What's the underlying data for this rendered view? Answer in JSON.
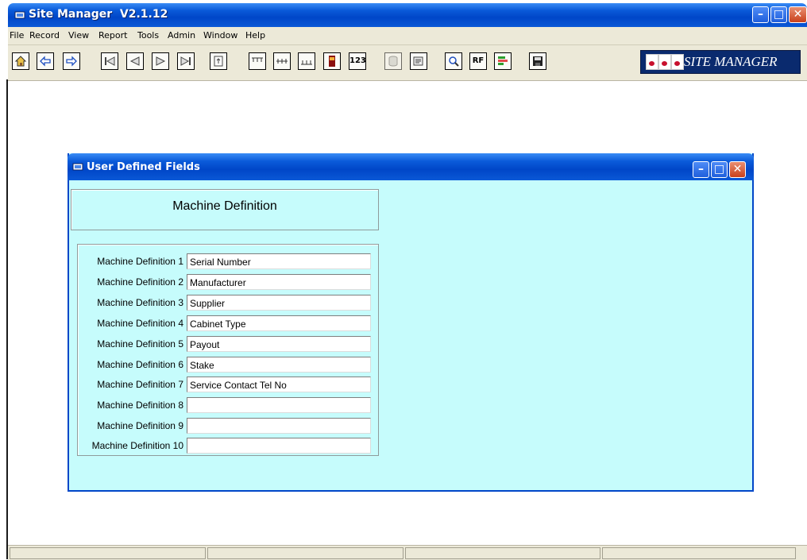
{
  "window": {
    "title": "Site Manager  V2.1.12",
    "controls": {
      "minimize": "–",
      "maximize": "□",
      "close": "✕"
    }
  },
  "menu": [
    "File",
    "Record",
    "View",
    "Report",
    "Tools",
    "Admin",
    "Window",
    "Help"
  ],
  "toolbar": {
    "buttons": [
      {
        "name": "home-icon"
      },
      {
        "name": "back-arrow-icon"
      },
      {
        "name": "forward-arrow-icon"
      },
      {
        "name": "first-record-icon"
      },
      {
        "name": "previous-record-icon"
      },
      {
        "name": "next-record-icon"
      },
      {
        "name": "last-record-icon"
      },
      {
        "name": "document-icon"
      },
      {
        "name": "layout-top-icon"
      },
      {
        "name": "layout-middle-icon"
      },
      {
        "name": "layout-bottom-icon"
      },
      {
        "name": "cabinet-icon"
      },
      {
        "name": "numbers-icon",
        "text": "123"
      },
      {
        "name": "database-icon"
      },
      {
        "name": "notes-icon"
      },
      {
        "name": "search-icon"
      },
      {
        "name": "rf-icon",
        "text": "RF"
      },
      {
        "name": "chart-icon"
      },
      {
        "name": "save-icon"
      }
    ],
    "logo_text": "SITE MANAGER"
  },
  "child_window": {
    "title": "User Defined Fields",
    "heading": "Machine Definition",
    "fields": [
      {
        "label": "Machine Definition 1",
        "value": "Serial Number"
      },
      {
        "label": "Machine Definition 2",
        "value": "Manufacturer"
      },
      {
        "label": "Machine Definition 3",
        "value": "Supplier"
      },
      {
        "label": "Machine Definition 4",
        "value": "Cabinet Type"
      },
      {
        "label": "Machine Definition 5",
        "value": "Payout"
      },
      {
        "label": "Machine Definition 6",
        "value": "Stake"
      },
      {
        "label": "Machine Definition 7",
        "value": "Service Contact Tel No"
      },
      {
        "label": "Machine Definition 8",
        "value": ""
      },
      {
        "label": "Machine Definition 9",
        "value": ""
      },
      {
        "label": "Machine Definition 10",
        "value": ""
      }
    ]
  },
  "colors": {
    "titlebar_blue": "#0046c8",
    "client_bg": "#c6fcfc",
    "chrome_bg": "#ece9d8",
    "close_red": "#c9401c"
  }
}
